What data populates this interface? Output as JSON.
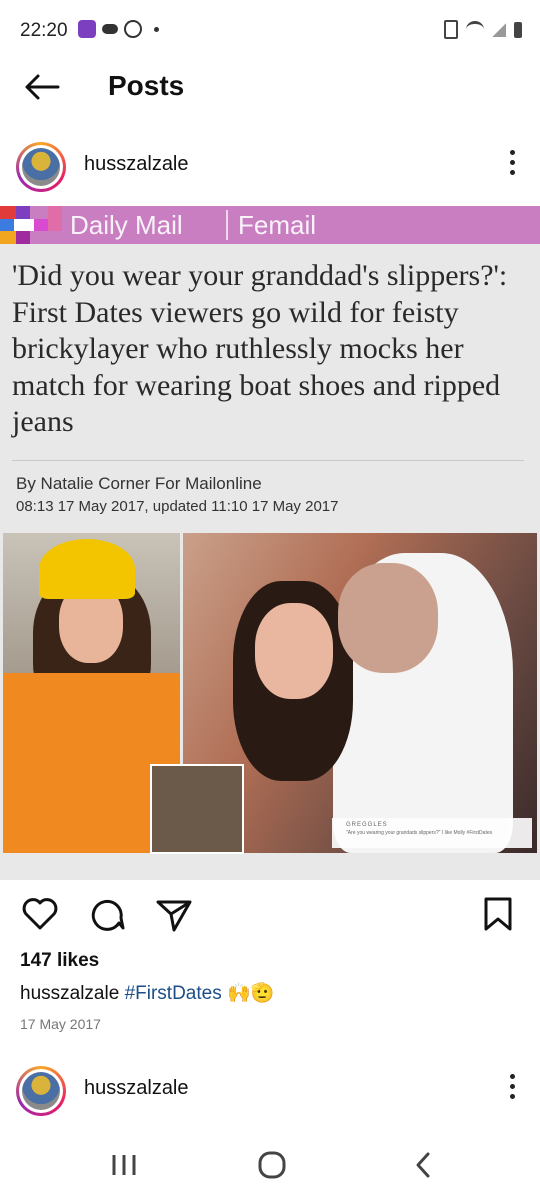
{
  "status_bar": {
    "time": "22:20"
  },
  "app_bar": {
    "title": "Posts"
  },
  "posts": [
    {
      "username": "husszalzale",
      "image": {
        "publisher": "Daily Mail",
        "section": "Femail",
        "headline": "'Did you wear your granddad's slippers?': First Dates viewers go wild for feisty brickylayer who ruthlessly mocks her match for wearing boat shoes and ripped jeans",
        "byline": "By Natalie Corner For Mailonline",
        "dateline": "08:13 17 May 2017, updated 11:10 17 May 2017",
        "tweet_handle": "GREGGLES",
        "tweet_text": "\"Are you wearing your grandads slippers?\" I like Molly #FirstDates"
      },
      "likes": "147 likes",
      "caption_user": "husszalzale",
      "caption_hashtag": "#FirstDates",
      "caption_emoji": "🙌🫡",
      "date": "17 May 2017"
    },
    {
      "username": "husszalzale"
    }
  ],
  "colors": {
    "dailymail_bar": "#c97ec2",
    "hashtag": "#1b4e8a"
  }
}
